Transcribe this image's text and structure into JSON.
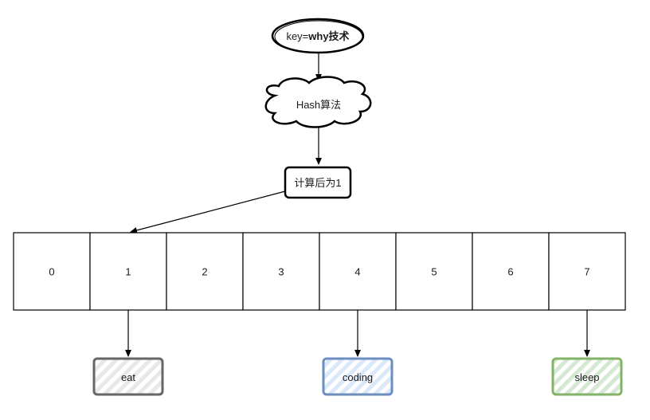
{
  "key_node": {
    "prefix": "key=",
    "value": "why技术"
  },
  "hash_node": {
    "label": "Hash算法"
  },
  "result_node": {
    "label": "计算后为1"
  },
  "buckets": [
    "0",
    "1",
    "2",
    "3",
    "4",
    "5",
    "6",
    "7"
  ],
  "values": [
    {
      "bucket": 1,
      "label": "eat",
      "color": "#666666",
      "fill": "#e8e8e8"
    },
    {
      "bucket": 4,
      "label": "coding",
      "color": "#6c8ebf",
      "fill": "#dae8fc"
    },
    {
      "bucket": 7,
      "label": "sleep",
      "color": "#82b366",
      "fill": "#d5e8d4"
    }
  ],
  "target_bucket": 1
}
